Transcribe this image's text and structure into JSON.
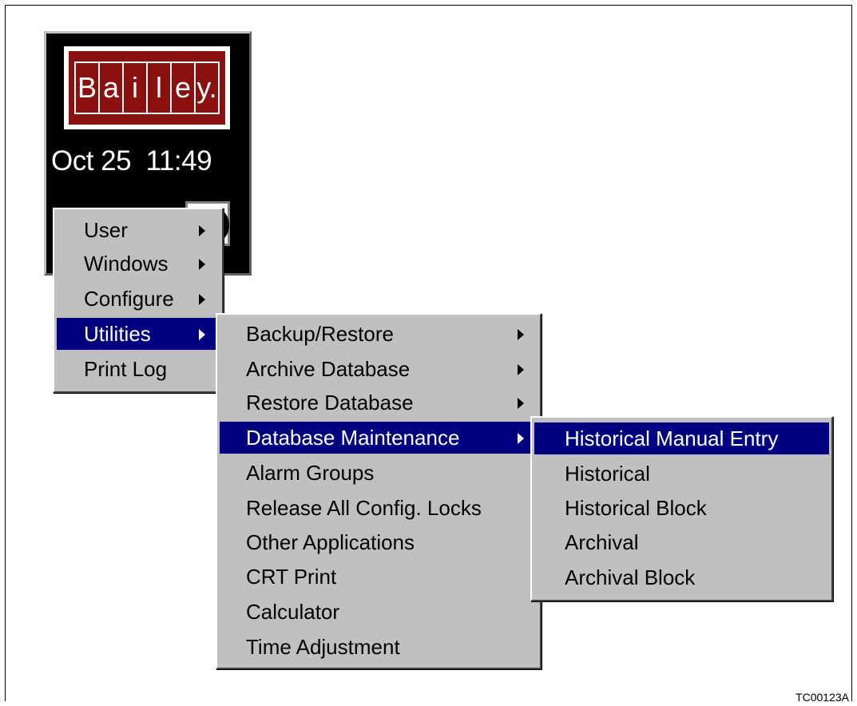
{
  "logo": {
    "letters": [
      "B",
      "a",
      "i",
      "l",
      "e",
      "y."
    ]
  },
  "status": {
    "date": "Oct 25",
    "time": "11:49"
  },
  "main_menu": {
    "items": [
      {
        "label": "User",
        "submenu": true
      },
      {
        "label": "Windows",
        "submenu": true
      },
      {
        "label": "Configure",
        "submenu": true
      },
      {
        "label": "Utilities",
        "submenu": true,
        "highlighted": true
      },
      {
        "label": "Print Log",
        "submenu": false
      }
    ]
  },
  "utilities_menu": {
    "items": [
      {
        "label": "Backup/Restore",
        "submenu": true
      },
      {
        "label": "Archive Database",
        "submenu": true
      },
      {
        "label": "Restore Database",
        "submenu": true
      },
      {
        "label": "Database Maintenance",
        "submenu": true,
        "highlighted": true
      },
      {
        "label": "Alarm Groups",
        "submenu": false
      },
      {
        "label": "Release All Config. Locks",
        "submenu": false
      },
      {
        "label": "Other Applications",
        "submenu": false
      },
      {
        "label": "CRT Print",
        "submenu": false
      },
      {
        "label": "Calculator",
        "submenu": false
      },
      {
        "label": "Time Adjustment",
        "submenu": false
      }
    ]
  },
  "maintenance_menu": {
    "items": [
      {
        "label": "Historical Manual Entry",
        "highlighted": true
      },
      {
        "label": "Historical"
      },
      {
        "label": "Historical Block"
      },
      {
        "label": "Archival"
      },
      {
        "label": "Archival Block"
      }
    ]
  },
  "figure_id": "TC00123A",
  "colors": {
    "highlight": "#000080",
    "menu_bg": "#c0c0c0",
    "logo_red": "#8b1010"
  }
}
